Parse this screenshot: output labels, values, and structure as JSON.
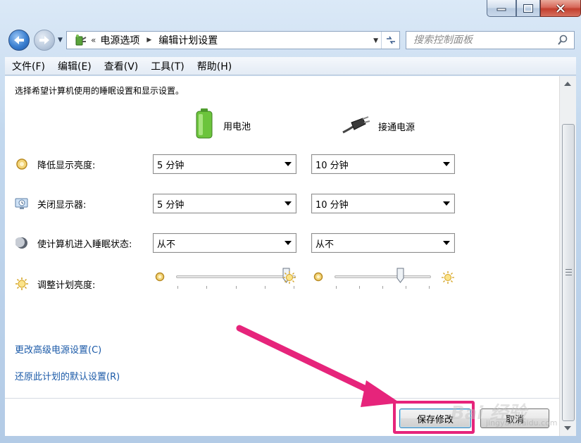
{
  "titlebar": {
    "minimize_icon": "minimize-icon",
    "maximize_icon": "maximize-icon",
    "close_icon": "close-icon"
  },
  "nav": {
    "back_icon": "back-arrow-icon",
    "forward_icon": "forward-arrow-icon",
    "address_icon": "power-options-icon",
    "crumbs": [
      "电源选项",
      "编辑计划设置"
    ],
    "refresh_icon": "refresh-icon"
  },
  "search": {
    "placeholder": "搜索控制面板",
    "icon": "search-icon"
  },
  "menu": [
    "文件(F)",
    "编辑(E)",
    "查看(V)",
    "工具(T)",
    "帮助(H)"
  ],
  "content": {
    "intro": "选择希望计算机使用的睡眠设置和显示设置。",
    "columns": {
      "battery": "用电池",
      "plugged": "接通电源"
    },
    "rows": [
      {
        "label": "降低显示亮度:",
        "icon": "dim-display-icon",
        "battery": "5 分钟",
        "plugged": "10 分钟"
      },
      {
        "label": "关闭显示器:",
        "icon": "monitor-off-icon",
        "battery": "5 分钟",
        "plugged": "10 分钟"
      },
      {
        "label": "使计算机进入睡眠状态:",
        "icon": "sleep-moon-icon",
        "battery": "从不",
        "plugged": "从不"
      }
    ],
    "brightness": {
      "label": "调整计划亮度:",
      "icon": "brightness-sun-icon",
      "battery_level": 0.95,
      "plugged_level": 0.7
    },
    "links": {
      "advanced": "更改高级电源设置(C)",
      "restore": "还原此计划的默认设置(R)"
    },
    "buttons": {
      "save": "保存修改",
      "cancel": "取消"
    }
  },
  "annotation": {
    "color": "#e6247b"
  },
  "watermark": {
    "main": "Bai 经验",
    "sub": "jingyan.baidu.com"
  }
}
